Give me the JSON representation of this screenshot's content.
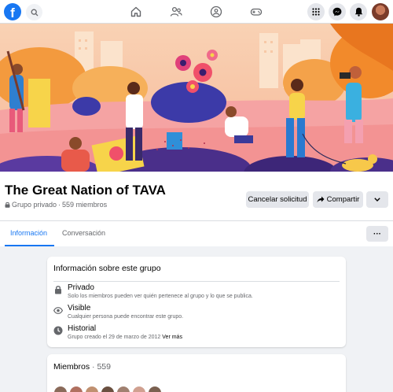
{
  "topbar": {
    "logo_letter": "f",
    "search_icon": "search-icon",
    "nav": [
      "home-icon",
      "friends-icon",
      "groups-icon",
      "gaming-icon"
    ],
    "actions": [
      "menu-grid-icon",
      "messenger-icon",
      "notifications-icon"
    ],
    "brand_color": "#1877f2"
  },
  "group": {
    "title": "The Great Nation of TAVA",
    "privacy": "Grupo privado",
    "separator": "·",
    "members_count_text": "559 miembros"
  },
  "buttons": {
    "cancel_request": "Cancelar solicitud",
    "share": "Compartir",
    "more": "chevron-down-icon"
  },
  "tabs": [
    {
      "label": "Información",
      "active": true
    },
    {
      "label": "Conversación",
      "active": false
    }
  ],
  "tabs_more": "···",
  "about": {
    "title": "Información sobre este grupo",
    "items": [
      {
        "icon": "lock-icon",
        "label": "Privado",
        "desc": "Solo los miembros pueden ver quién pertenece al grupo y lo que se publica."
      },
      {
        "icon": "eye-icon",
        "label": "Visible",
        "desc": "Cualquier persona puede encontrar este grupo."
      },
      {
        "icon": "clock-icon",
        "label": "Historial",
        "desc": "Grupo creado el 29 de marzo de 2012",
        "link": "Ver más"
      }
    ]
  },
  "members": {
    "title": "Miembros",
    "separator": " · ",
    "count": "559",
    "avatar_colors": [
      "#8a6a5a",
      "#b07060",
      "#c09070",
      "#6a5040",
      "#a08070",
      "#d0a090",
      "#7a6050"
    ]
  }
}
